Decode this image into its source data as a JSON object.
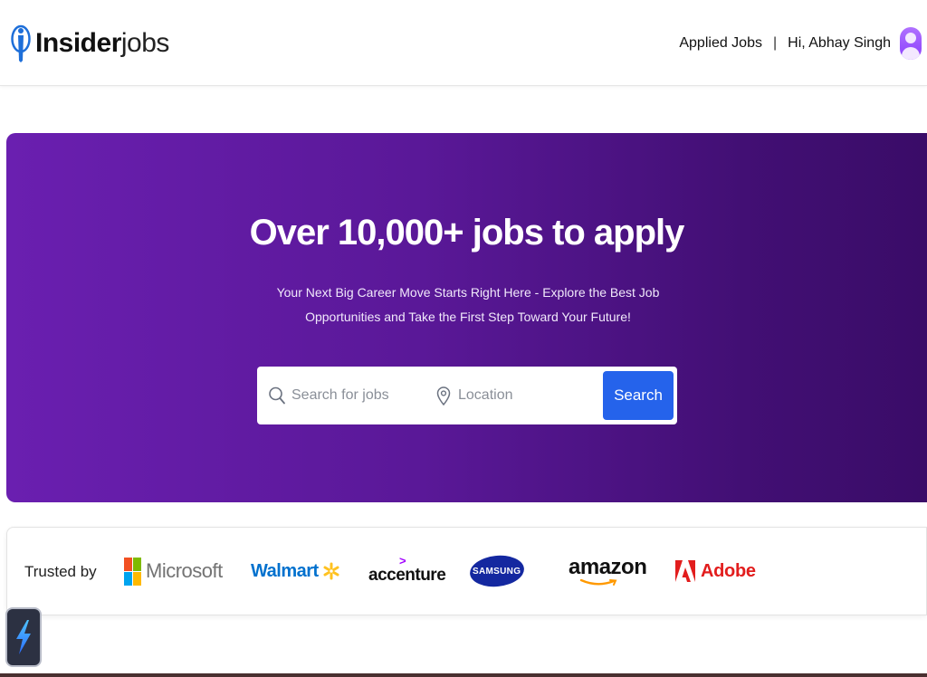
{
  "header": {
    "logo_bold": "Insider",
    "logo_light": "jobs",
    "logo_icon": "insider-person-icon",
    "applied_jobs_label": "Applied Jobs",
    "separator": "|",
    "greeting": "Hi, Abhay Singh",
    "avatar_icon": "user-avatar-icon"
  },
  "hero": {
    "title": "Over 10,000+ jobs to apply",
    "subtitle": "Your Next Big Career Move Starts Right Here - Explore the Best Job Opportunities and Take the First Step Toward Your Future!",
    "search": {
      "jobs_placeholder": "Search for jobs",
      "jobs_value": "",
      "jobs_icon": "search-icon",
      "location_placeholder": "Location",
      "location_value": "",
      "location_icon": "location-pin-icon",
      "button_label": "Search"
    },
    "colors": {
      "gradient_start": "#6a1fb0",
      "gradient_end": "#3a0c68",
      "button": "#2563eb"
    }
  },
  "trusted": {
    "label": "Trusted by",
    "brands": {
      "microsoft": "Microsoft",
      "walmart": "Walmart",
      "accenture": "accenture",
      "samsung": "SAMSUNG",
      "amazon": "amazon",
      "adobe": "Adobe"
    }
  },
  "widget": {
    "icon": "lightning-bolt-icon"
  }
}
